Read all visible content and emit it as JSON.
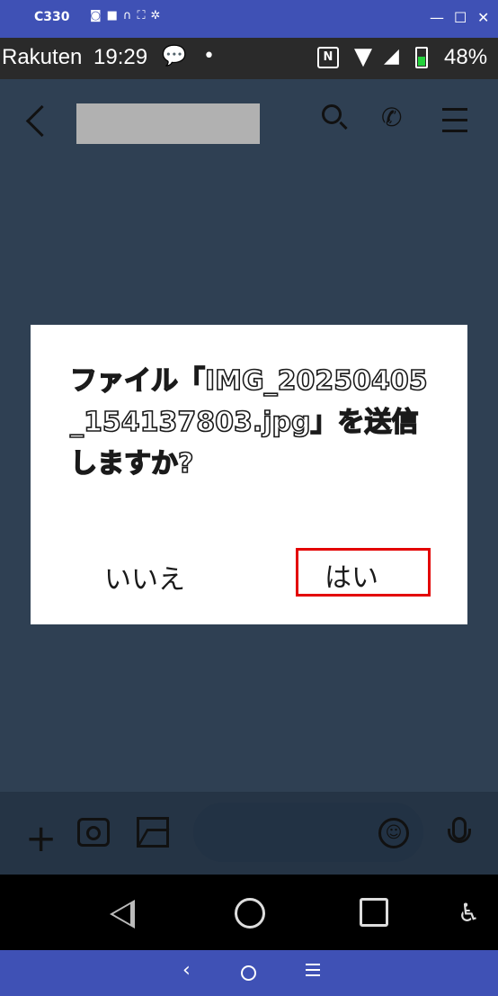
{
  "emulator": {
    "title": "C330",
    "tool_icons": [
      "camera-icon",
      "video-icon",
      "headphones-icon",
      "fullscreen-icon",
      "settings-icon"
    ],
    "window_controls": [
      "minimize-icon",
      "maximize-icon",
      "close-icon"
    ],
    "minimize_glyph": "—",
    "maximize_glyph": "☐",
    "close_glyph": "✕",
    "bottom_icons": [
      "back-icon",
      "home-icon",
      "menu-icon"
    ],
    "back_glyph": "‹"
  },
  "status_bar": {
    "carrier": "Rakuten",
    "time": "19:29",
    "nfc_glyph": "N",
    "battery": "48%",
    "battery_level": 0.48
  },
  "chat_header": {
    "icons": [
      "back-chevron-icon",
      "search-icon",
      "phone-icon",
      "menu-icon"
    ]
  },
  "dialog": {
    "message": "ファイル「IMG_20250405_154137803.jpg」を送信しますか?",
    "cancel_label": "いいえ",
    "confirm_label": "はい"
  },
  "input_bar": {
    "icons": [
      "plus-icon",
      "camera-icon",
      "image-icon",
      "emoji-icon",
      "microphone-icon"
    ],
    "plus_glyph": "+",
    "emoji_glyph": "☺"
  },
  "nav_bar": {
    "icons": [
      "back-icon",
      "home-icon",
      "recents-icon",
      "accessibility-icon"
    ],
    "accessibility_glyph": "♿"
  },
  "colors": {
    "emulator_frame": "#3f51b5",
    "backdrop": "#2f4053",
    "highlight": "#e30000"
  }
}
